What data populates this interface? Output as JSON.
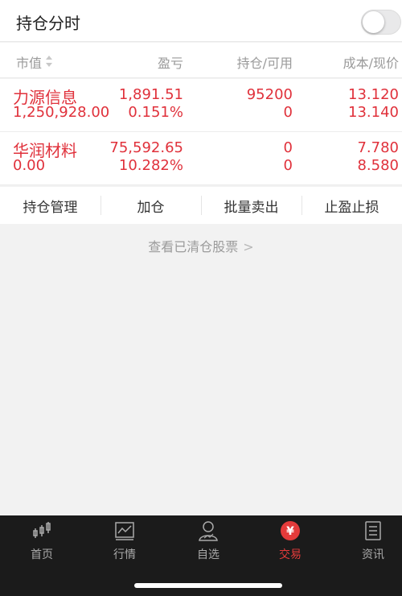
{
  "toggle": {
    "label": "持仓分时",
    "on": false
  },
  "header": {
    "market_value": "市值",
    "pnl": "盈亏",
    "position": "持仓/可用",
    "cost_price": "成本/现价"
  },
  "positions": [
    {
      "name": "力源信息",
      "market_value": "1,250,928.00",
      "pnl": "1,891.51",
      "pnl_pct": "0.151%",
      "position": "95200",
      "available": "0",
      "cost": "13.120",
      "price": "13.140"
    },
    {
      "name": "华润材料",
      "market_value": "0.00",
      "pnl": "75,592.65",
      "pnl_pct": "10.282%",
      "position": "0",
      "available": "0",
      "cost": "7.780",
      "price": "8.580"
    }
  ],
  "actions": {
    "manage": "持仓管理",
    "add": "加仓",
    "batch_sell": "批量卖出",
    "tp_sl": "止盈止损"
  },
  "cleared_link": "查看已清仓股票",
  "tabs": [
    {
      "label": "首页",
      "icon": "candlestick-icon"
    },
    {
      "label": "行情",
      "icon": "chart-icon"
    },
    {
      "label": "自选",
      "icon": "person-icon"
    },
    {
      "label": "交易",
      "icon": "yen-icon",
      "active": true
    },
    {
      "label": "资讯",
      "icon": "news-icon"
    }
  ],
  "colors": {
    "red": "#e0313b",
    "tab_active": "#e43b3b",
    "tabbar_bg": "#1b1b1b"
  }
}
